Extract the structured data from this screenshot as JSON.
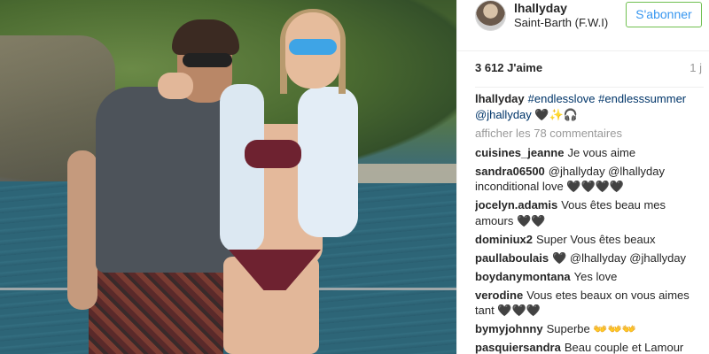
{
  "post": {
    "photo_alt": "Couple posing on a boat with sea and green hills behind",
    "colors": {
      "link": "#003569",
      "follow_text": "#3897f0",
      "follow_border": "#70c050",
      "muted": "#999999"
    }
  },
  "header": {
    "username": "lhallyday",
    "location": "Saint-Barth (F.W.I)",
    "follow_label": "S'abonner"
  },
  "stats": {
    "likes": "3 612 J'aime",
    "time_ago": "1 j"
  },
  "caption": {
    "author": "lhallyday",
    "text": "#endlesslove #endlesssummer @jhallyday 🖤✨🎧"
  },
  "load_more": "afficher les 78 commentaires",
  "comments": [
    {
      "author": "cuisines_jeanne",
      "text": "Je vous aime"
    },
    {
      "author": "sandra06500",
      "text": "@jhallyday @lhallyday inconditional love 🖤🖤🖤🖤"
    },
    {
      "author": "jocelyn.adamis",
      "text": "Vous êtes beau mes amours 🖤🖤"
    },
    {
      "author": "dominiux2",
      "text": "Super Vous êtes beaux"
    },
    {
      "author": "paullaboulais",
      "text": "🖤 @lhallyday @jhallyday"
    },
    {
      "author": "boydanymontana",
      "text": "Yes love"
    },
    {
      "author": "verodine",
      "text": "Vous etes beaux on vous aimes tant 🖤🖤🖤"
    },
    {
      "author": "bymyjohnny",
      "text": "Superbe 👐👐👐"
    },
    {
      "author": "pasquiersandra",
      "text": "Beau couple et Lamour"
    }
  ]
}
